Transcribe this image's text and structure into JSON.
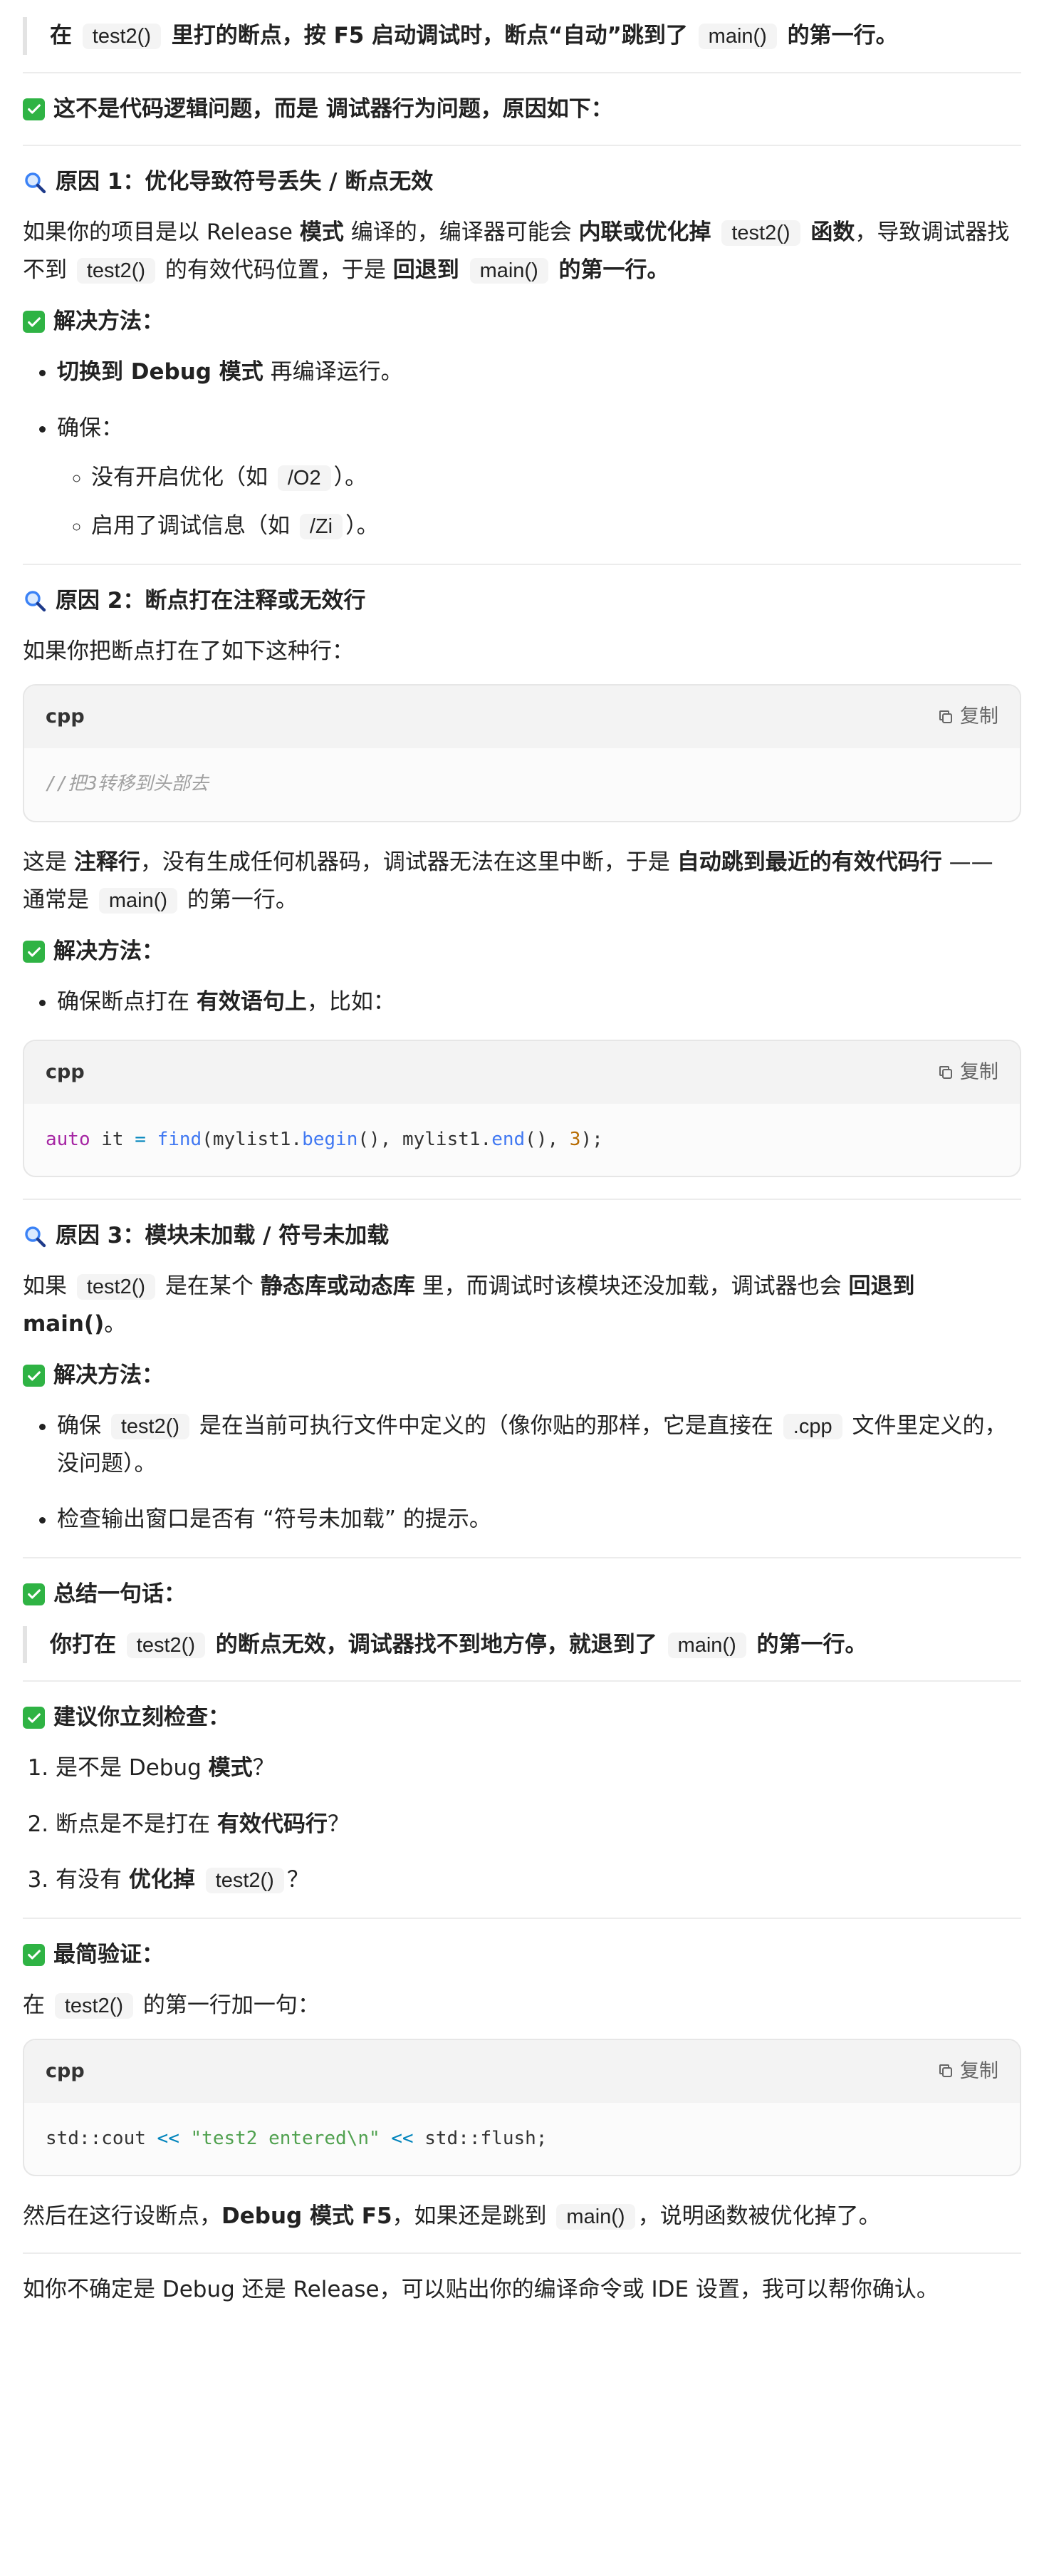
{
  "intro": {
    "quote": [
      {
        "t": "在 ",
        "b": true
      },
      {
        "code": "test2()"
      },
      {
        "t": " 里打的断点，按 F5 启动调试时，断点“自动”跳到了 ",
        "b": true
      },
      {
        "code": "main()"
      },
      {
        "t": " 的第一行。",
        "b": true
      }
    ],
    "summary_heading": "这不是代码逻辑问题，而是 调试器行为问题，原因如下："
  },
  "reason1": {
    "heading": "原因 1：优化导致符号丢失 / 断点无效",
    "para": [
      {
        "t": "如果你的项目是以 Release "
      },
      {
        "t": "模式",
        "b": true
      },
      {
        "t": " 编译的，编译器可能会 "
      },
      {
        "t": "内联或优化掉 ",
        "b": true
      },
      {
        "code": "test2()"
      },
      {
        "t": " 函数",
        "b": true
      },
      {
        "t": "，导致调试器找不到 "
      },
      {
        "code": "test2()"
      },
      {
        "t": " 的有效代码位置，于是 "
      },
      {
        "t": "回退到 ",
        "b": true
      },
      {
        "code": "main()"
      },
      {
        "t": " 的第一行。",
        "b": true
      }
    ],
    "solution_heading": "解决方法：",
    "bullet1": [
      {
        "t": "切换到 Debug ",
        "b": true
      },
      {
        "t": "模式",
        "b": true
      },
      {
        "t": " 再编译运行。"
      }
    ],
    "bullet2": "确保：",
    "sub1": [
      {
        "t": "没有开启优化（如 "
      },
      {
        "code": "/O2"
      },
      {
        "t": "）。"
      }
    ],
    "sub2": [
      {
        "t": "启用了调试信息（如 "
      },
      {
        "code": "/Zi"
      },
      {
        "t": "）。"
      }
    ]
  },
  "reason2": {
    "heading": "原因 2：断点打在注释或无效行",
    "intro": "如果你把断点打在了如下这种行：",
    "code1": {
      "lang": "cpp",
      "copy": "复制",
      "line": "//把3转移到头部去"
    },
    "para": [
      {
        "t": "这是 "
      },
      {
        "t": "注释行",
        "b": true
      },
      {
        "t": "，没有生成任何机器码，调试器无法在这里中断，于是 "
      },
      {
        "t": "自动跳到最近的有效代码行",
        "b": true
      },
      {
        "t": " —— 通常是 "
      },
      {
        "code": "main()"
      },
      {
        "t": " 的第一行。"
      }
    ],
    "solution_heading": "解决方法：",
    "bullet1": [
      {
        "t": "确保断点打在 "
      },
      {
        "t": "有效语句上",
        "b": true
      },
      {
        "t": "，比如："
      }
    ],
    "code2": {
      "lang": "cpp",
      "copy": "复制",
      "tokens": [
        {
          "c": "kw",
          "t": "auto"
        },
        {
          "c": "",
          "t": " it "
        },
        {
          "c": "op",
          "t": "="
        },
        {
          "c": "",
          "t": " "
        },
        {
          "c": "fn",
          "t": "find"
        },
        {
          "c": "",
          "t": "(mylist1."
        },
        {
          "c": "fn",
          "t": "begin"
        },
        {
          "c": "",
          "t": "(), mylist1."
        },
        {
          "c": "fn",
          "t": "end"
        },
        {
          "c": "",
          "t": "(), "
        },
        {
          "c": "num",
          "t": "3"
        },
        {
          "c": "",
          "t": ");"
        }
      ]
    }
  },
  "reason3": {
    "heading": "原因 3：模块未加载 / 符号未加载",
    "para": [
      {
        "t": "如果 "
      },
      {
        "code": "test2()"
      },
      {
        "t": " 是在某个 "
      },
      {
        "t": "静态库或动态库",
        "b": true
      },
      {
        "t": " 里，而调试时该模块还没加载，调试器也会 "
      },
      {
        "t": "回退到 main()",
        "b": true
      },
      {
        "t": "。"
      }
    ],
    "solution_heading": "解决方法：",
    "bullet1": [
      {
        "t": "确保 "
      },
      {
        "code": "test2()"
      },
      {
        "t": " 是在当前可执行文件中定义的（像你贴的那样，它是直接在 "
      },
      {
        "code": ".cpp"
      },
      {
        "t": " 文件里定义的，没问题）。"
      }
    ],
    "bullet2": "检查输出窗口是否有 “符号未加载” 的提示。"
  },
  "summary": {
    "heading": "总结一句话：",
    "quote": [
      {
        "t": "你打在 ",
        "b": true
      },
      {
        "code": "test2()"
      },
      {
        "t": " 的断点无效，调试器找不到地方停，就退到了 ",
        "b": true
      },
      {
        "code": "main()"
      },
      {
        "t": " 的第一行。",
        "b": true
      }
    ]
  },
  "checklist": {
    "heading": "建议你立刻检查：",
    "item1": [
      {
        "t": "是不是 Debug "
      },
      {
        "t": "模式",
        "b": true
      },
      {
        "t": "？"
      }
    ],
    "item2": [
      {
        "t": "断点是不是打在 "
      },
      {
        "t": "有效代码行",
        "b": true
      },
      {
        "t": "？"
      }
    ],
    "item3": [
      {
        "t": "有没有 "
      },
      {
        "t": "优化掉 ",
        "b": true
      },
      {
        "code": "test2()"
      },
      {
        "t": "？"
      }
    ]
  },
  "verify": {
    "heading": "最简验证：",
    "intro": [
      {
        "t": "在 "
      },
      {
        "code": "test2()"
      },
      {
        "t": " 的第一行加一句："
      }
    ],
    "code3": {
      "lang": "cpp",
      "copy": "复制",
      "tokens": [
        {
          "c": "",
          "t": "std::cout "
        },
        {
          "c": "op",
          "t": "<<"
        },
        {
          "c": "",
          "t": " "
        },
        {
          "c": "str",
          "t": "\"test2 entered\\n\""
        },
        {
          "c": "",
          "t": " "
        },
        {
          "c": "op",
          "t": "<<"
        },
        {
          "c": "",
          "t": " std::flush;"
        }
      ]
    },
    "para": [
      {
        "t": "然后在这行设断点，"
      },
      {
        "t": "Debug ",
        "b": true
      },
      {
        "t": "模式",
        "b": true
      },
      {
        "t": " F5",
        "b": true
      },
      {
        "t": "，如果还是跳到 "
      },
      {
        "code": "main()"
      },
      {
        "t": "，说明函数被优化掉了。"
      }
    ]
  },
  "footer": "如你不确定是 Debug 还是 Release，可以贴出你的编译命令或 IDE 设置，我可以帮你确认。",
  "colors": {
    "check_green": "#2fb344",
    "search_blue": "#3b82f6",
    "inline_code_bg": "#f4f4f4"
  }
}
